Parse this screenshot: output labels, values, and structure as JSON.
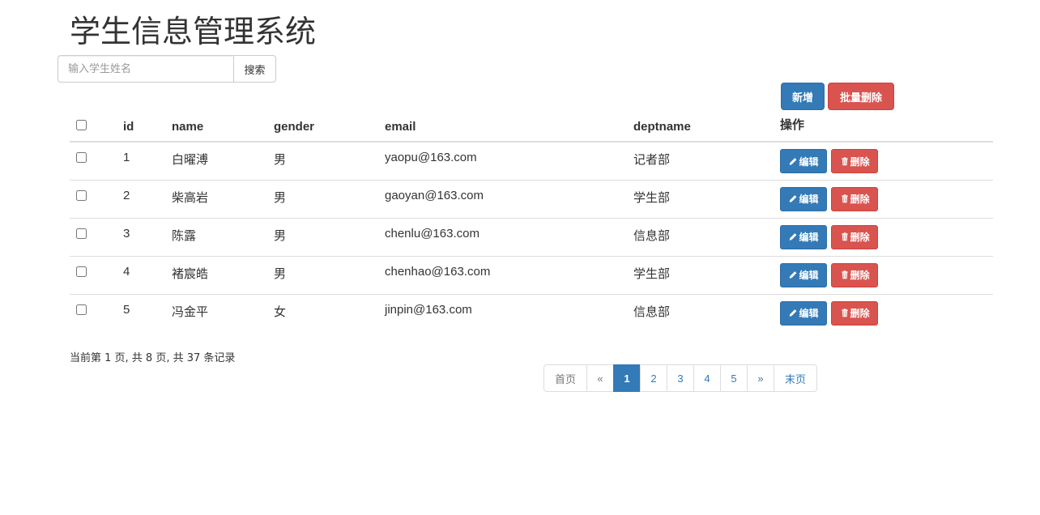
{
  "page_title": "学生信息管理系统",
  "search": {
    "placeholder": "输入学生姓名",
    "value": "",
    "button_label": "搜索"
  },
  "actions": {
    "add_label": "新增",
    "batch_delete_label": "批量删除"
  },
  "table": {
    "headers": {
      "id": "id",
      "name": "name",
      "gender": "gender",
      "email": "email",
      "deptname": "deptname",
      "operations": "操作"
    },
    "rows": [
      {
        "id": "1",
        "name": "白曜溥",
        "gender": "男",
        "email": "yaopu@163.com",
        "deptname": "记者部"
      },
      {
        "id": "2",
        "name": "柴高岩",
        "gender": "男",
        "email": "gaoyan@163.com",
        "deptname": "学生部"
      },
      {
        "id": "3",
        "name": "陈露",
        "gender": "男",
        "email": "chenlu@163.com",
        "deptname": "信息部"
      },
      {
        "id": "4",
        "name": "褚宸皓",
        "gender": "男",
        "email": "chenhao@163.com",
        "deptname": "学生部"
      },
      {
        "id": "5",
        "name": "冯金平",
        "gender": "女",
        "email": "jinpin@163.com",
        "deptname": "信息部"
      }
    ],
    "edit_label": "编辑",
    "delete_label": "删除"
  },
  "record_info": "当前第 1 页, 共 8 页, 共 37 条记录",
  "pagination": {
    "first": "首页",
    "prev": "«",
    "pages": [
      "1",
      "2",
      "3",
      "4",
      "5"
    ],
    "next": "»",
    "last": "末页",
    "active": "1"
  },
  "colors": {
    "primary": "#337ab7",
    "danger": "#d9534f"
  },
  "icons": {
    "edit": "pencil-icon",
    "delete": "trash-icon"
  }
}
